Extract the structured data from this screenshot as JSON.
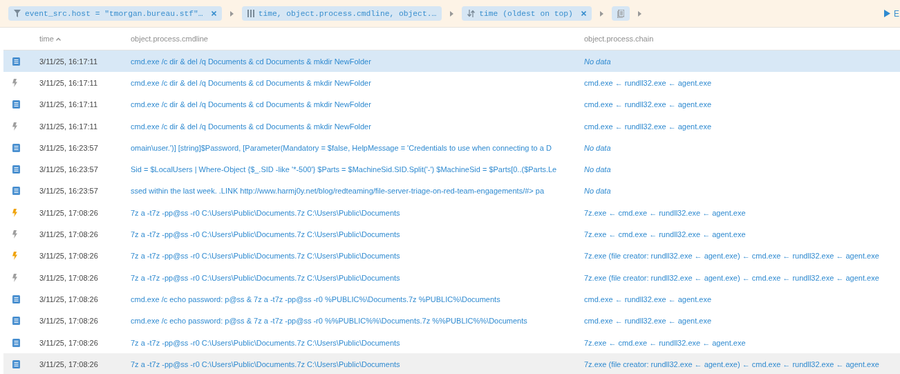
{
  "toolbar": {
    "chips": [
      {
        "kind": "filter",
        "label": "event_src.host = \"tmorgan.bureau.stf\"…",
        "closable": true
      },
      {
        "kind": "columns",
        "label": "time, object.process.cmdline, object.…",
        "closable": false
      },
      {
        "kind": "sort",
        "label": "time (oldest on top)",
        "closable": true
      },
      {
        "kind": "format",
        "closable": false
      }
    ],
    "run_label": "E"
  },
  "table": {
    "columns": [
      {
        "label": "time",
        "sorted": true
      },
      {
        "label": "object.process.cmdline",
        "sorted": false
      },
      {
        "label": "object.process.chain",
        "sorted": false
      }
    ],
    "rows": [
      {
        "kind": "log",
        "selected": true,
        "hovered": false,
        "time": "3/11/25, 16:17:11",
        "cmdline": "cmd.exe /c dir & del /q Documents & cd Documents & mkdir NewFolder",
        "chain": "No data",
        "chain_empty": true
      },
      {
        "kind": "alert",
        "color": "#9e9e9e",
        "selected": false,
        "hovered": false,
        "time": "3/11/25, 16:17:11",
        "cmdline": "cmd.exe /c dir & del /q Documents & cd Documents & mkdir NewFolder",
        "chain": "cmd.exe ← rundll32.exe ← agent.exe",
        "chain_empty": false
      },
      {
        "kind": "log",
        "selected": false,
        "hovered": false,
        "time": "3/11/25, 16:17:11",
        "cmdline": "cmd.exe /c dir & del /q Documents & cd Documents & mkdir NewFolder",
        "chain": "cmd.exe ← rundll32.exe ← agent.exe",
        "chain_empty": false
      },
      {
        "kind": "alert",
        "color": "#9e9e9e",
        "selected": false,
        "hovered": false,
        "time": "3/11/25, 16:17:11",
        "cmdline": "cmd.exe /c dir & del /q Documents & cd Documents & mkdir NewFolder",
        "chain": "cmd.exe ← rundll32.exe ← agent.exe",
        "chain_empty": false
      },
      {
        "kind": "log",
        "selected": false,
        "hovered": false,
        "time": "3/11/25, 16:23:57",
        "cmdline": "omain\\user.')] [string]$Password, [Parameter(Mandatory = $false, HelpMessage = 'Credentials to use when connecting to a D",
        "chain": "No data",
        "chain_empty": true
      },
      {
        "kind": "log",
        "selected": false,
        "hovered": false,
        "time": "3/11/25, 16:23:57",
        "cmdline": "Sid = $LocalUsers | Where-Object {$_.SID -like '*-500'} $Parts = $MachineSid.SID.Split('-') $MachineSid = $Parts[0..($Parts.Le",
        "chain": "No data",
        "chain_empty": true
      },
      {
        "kind": "log",
        "selected": false,
        "hovered": false,
        "time": "3/11/25, 16:23:57",
        "cmdline": "ssed within the last week. .LINK http://www.harmj0y.net/blog/redteaming/file-server-triage-on-red-team-engagements/#> pa",
        "chain": "No data",
        "chain_empty": true
      },
      {
        "kind": "alert",
        "color": "#f0a30a",
        "selected": false,
        "hovered": false,
        "time": "3/11/25, 17:08:26",
        "cmdline": "7z a -t7z -pp@ss -r0 C:\\Users\\Public\\Documents.7z C:\\Users\\Public\\Documents",
        "chain": "7z.exe ← cmd.exe ← rundll32.exe ← agent.exe",
        "chain_empty": false
      },
      {
        "kind": "alert",
        "color": "#9e9e9e",
        "selected": false,
        "hovered": false,
        "time": "3/11/25, 17:08:26",
        "cmdline": "7z a -t7z -pp@ss -r0 C:\\Users\\Public\\Documents.7z C:\\Users\\Public\\Documents",
        "chain": "7z.exe ← cmd.exe ← rundll32.exe ← agent.exe",
        "chain_empty": false
      },
      {
        "kind": "alert",
        "color": "#f0a30a",
        "selected": false,
        "hovered": false,
        "time": "3/11/25, 17:08:26",
        "cmdline": "7z a -t7z -pp@ss -r0 C:\\Users\\Public\\Documents.7z C:\\Users\\Public\\Documents",
        "chain": "7z.exe (file creator: rundll32.exe ← agent.exe) ← cmd.exe ← rundll32.exe ← agent.exe",
        "chain_empty": false
      },
      {
        "kind": "alert",
        "color": "#9e9e9e",
        "selected": false,
        "hovered": false,
        "time": "3/11/25, 17:08:26",
        "cmdline": "7z a -t7z -pp@ss -r0 C:\\Users\\Public\\Documents.7z C:\\Users\\Public\\Documents",
        "chain": "7z.exe (file creator: rundll32.exe ← agent.exe) ← cmd.exe ← rundll32.exe ← agent.exe",
        "chain_empty": false
      },
      {
        "kind": "log",
        "selected": false,
        "hovered": false,
        "time": "3/11/25, 17:08:26",
        "cmdline": "cmd.exe /c echo password: p@ss & 7z a -t7z -pp@ss -r0 %PUBLIC%\\Documents.7z %PUBLIC%\\Documents",
        "chain": "cmd.exe ← rundll32.exe ← agent.exe",
        "chain_empty": false
      },
      {
        "kind": "log",
        "selected": false,
        "hovered": false,
        "time": "3/11/25, 17:08:26",
        "cmdline": "cmd.exe /c echo password: p@ss & 7z a -t7z -pp@ss -r0 %%PUBLIC%%\\Documents.7z %%PUBLIC%%\\Documents",
        "chain": "cmd.exe ← rundll32.exe ← agent.exe",
        "chain_empty": false
      },
      {
        "kind": "log",
        "selected": false,
        "hovered": false,
        "time": "3/11/25, 17:08:26",
        "cmdline": "7z a -t7z -pp@ss -r0 C:\\Users\\Public\\Documents.7z C:\\Users\\Public\\Documents",
        "chain": "7z.exe ← cmd.exe ← rundll32.exe ← agent.exe",
        "chain_empty": false
      },
      {
        "kind": "log",
        "selected": false,
        "hovered": true,
        "time": "3/11/25, 17:08:26",
        "cmdline": "7z a -t7z -pp@ss -r0 C:\\Users\\Public\\Documents.7z C:\\Users\\Public\\Documents",
        "chain": "7z.exe (file creator: rundll32.exe ← agent.exe) ← cmd.exe ← rundll32.exe ← agent.exe",
        "chain_empty": false
      }
    ]
  }
}
